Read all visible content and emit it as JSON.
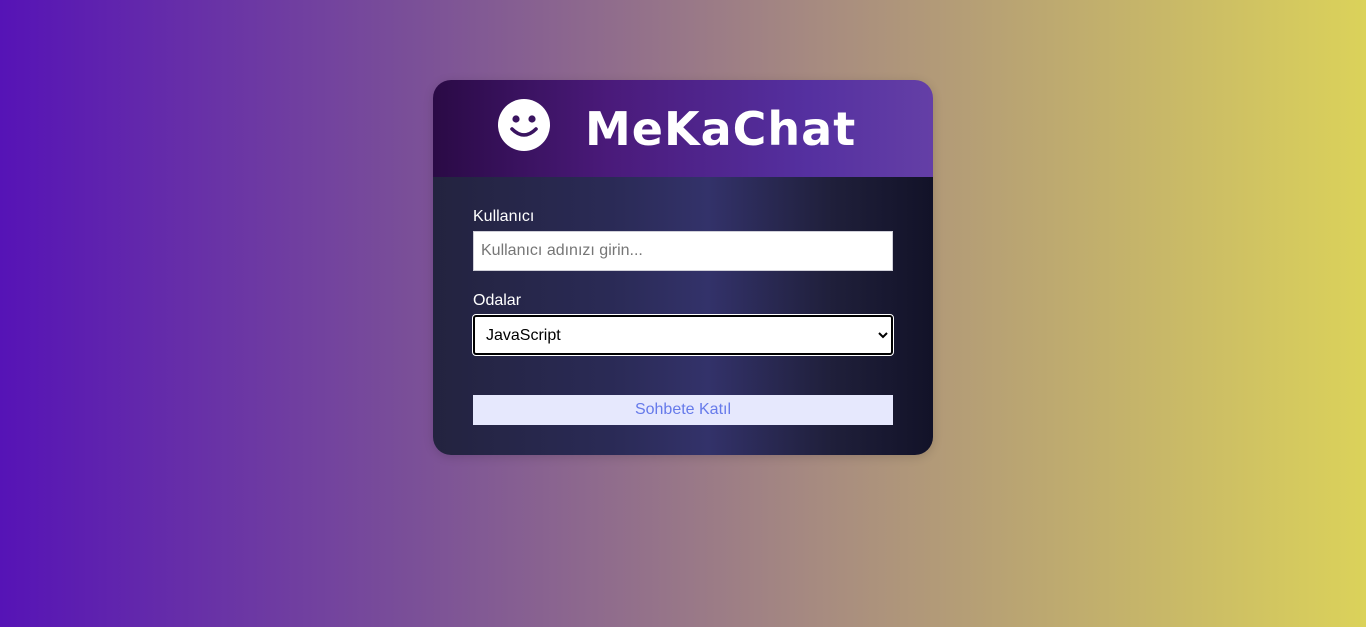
{
  "header": {
    "title": "MeKaChat",
    "logo_icon": "smiley-face-icon"
  },
  "form": {
    "user_label": "Kullanıcı",
    "user_placeholder": "Kullanıcı adınızı girin...",
    "user_value": "",
    "rooms_label": "Odalar",
    "rooms_selected": "JavaScript",
    "join_label": "Sohbete Katıl"
  },
  "colors": {
    "background_left": "#5613b6",
    "background_right": "#dbd25a",
    "header_bg": "#4a1a7a",
    "body_bg": "#2a2a55",
    "button_bg": "#e6e8fd",
    "button_text": "#667aea"
  }
}
